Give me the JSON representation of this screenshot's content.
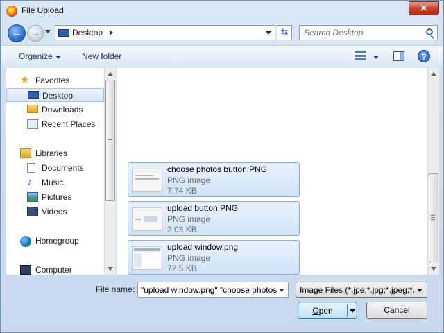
{
  "window": {
    "title": "File Upload",
    "close_label": "✕"
  },
  "address": {
    "location": "Desktop"
  },
  "search": {
    "placeholder": "Search Desktop"
  },
  "toolbar": {
    "organize_label": "Organize",
    "new_folder_label": "New folder",
    "help_label": "?"
  },
  "sidebar": {
    "items": [
      {
        "label": "Favorites"
      },
      {
        "label": "Desktop"
      },
      {
        "label": "Downloads"
      },
      {
        "label": "Recent Places"
      },
      {
        "label": "Libraries"
      },
      {
        "label": "Documents"
      },
      {
        "label": "Music"
      },
      {
        "label": "Pictures"
      },
      {
        "label": "Videos"
      },
      {
        "label": "Homegroup"
      },
      {
        "label": "Computer"
      }
    ]
  },
  "files": [
    {
      "name": "choose photos button.PNG",
      "type": "PNG image",
      "size": "7.74 KB"
    },
    {
      "name": "upload button.PNG",
      "type": "PNG image",
      "size": "2.03 KB"
    },
    {
      "name": "upload window.png",
      "type": "PNG image",
      "size": "72.5 KB"
    }
  ],
  "bottom": {
    "file_name_label_pre": "File ",
    "file_name_label_key": "n",
    "file_name_label_post": "ame:",
    "file_name_value": "\"upload window.png\" \"choose photos button.PNG\" \"upload button.PNG\"",
    "filter_value": "Image Files (*.jpe;*.jpg;*.jpeg;*.",
    "open_key": "O",
    "open_rest": "pen",
    "cancel_label": "Cancel"
  },
  "colors": {
    "accent": "#3c7fb1",
    "selection": "#cfe2f8",
    "close": "#c7402b"
  }
}
